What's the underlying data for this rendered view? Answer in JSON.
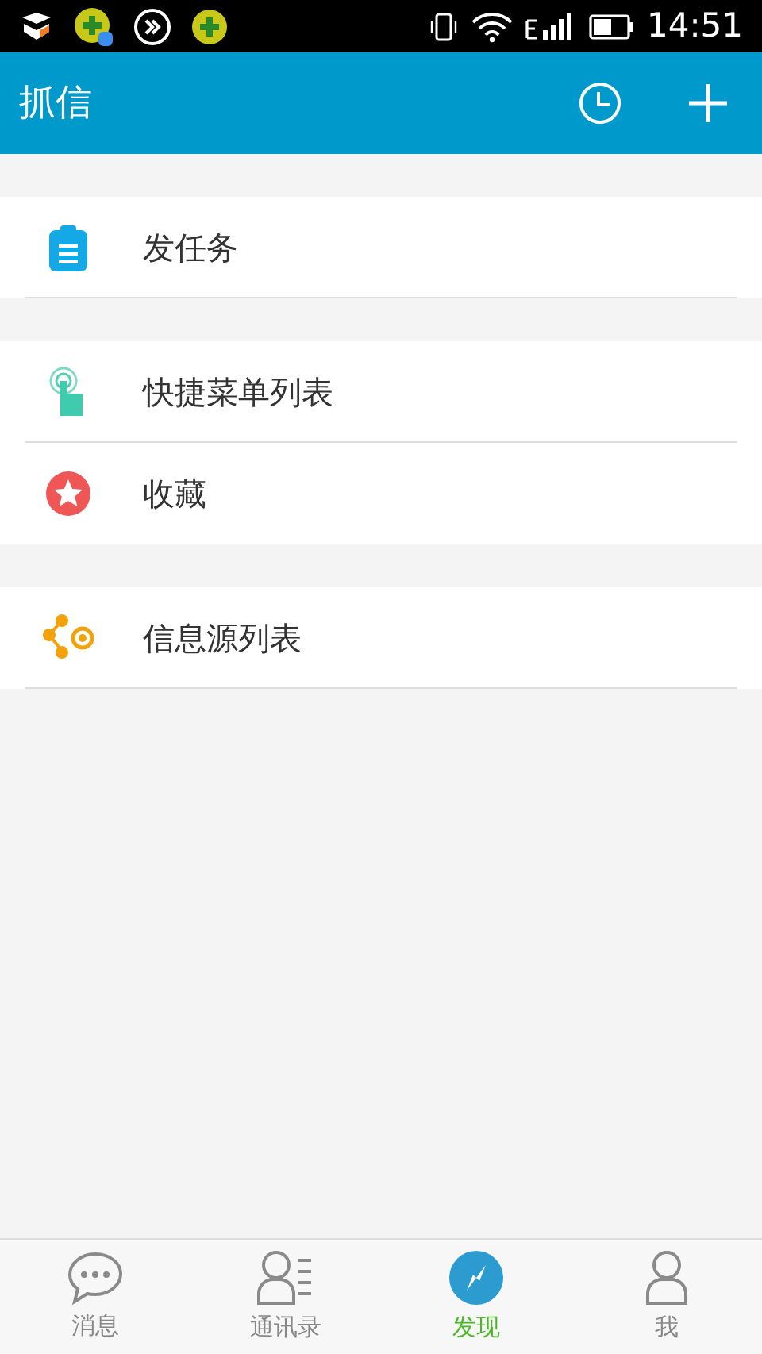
{
  "status_bar": {
    "time": "14:51"
  },
  "header": {
    "title": "抓信"
  },
  "groups": [
    {
      "items": [
        {
          "kind": "task",
          "label": "发任务",
          "divider": true
        }
      ]
    },
    {
      "items": [
        {
          "kind": "touch",
          "label": "快捷菜单列表",
          "divider": true
        },
        {
          "kind": "star",
          "label": "收藏",
          "divider": false
        }
      ]
    },
    {
      "items": [
        {
          "kind": "source",
          "label": "信息源列表",
          "divider": true
        }
      ]
    }
  ],
  "tabs": [
    {
      "kind": "chat",
      "label": "消息",
      "selected": false
    },
    {
      "kind": "contacts",
      "label": "通讯录",
      "selected": false
    },
    {
      "kind": "discover",
      "label": "发现",
      "selected": true
    },
    {
      "kind": "me",
      "label": "我",
      "selected": false
    }
  ]
}
